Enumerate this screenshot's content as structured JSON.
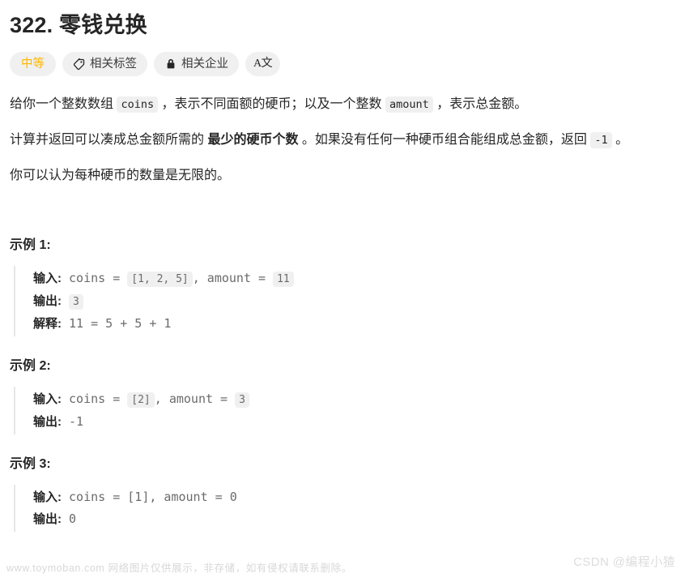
{
  "problem": {
    "title": "322. 零钱兑换",
    "number": "322.",
    "name": "零钱兑换"
  },
  "badges": {
    "difficulty": "中等",
    "tags": "相关标签",
    "companies": "相关企业",
    "translate_glyph": "A文"
  },
  "description": {
    "p1_a": "给你一个整数数组 ",
    "p1_code1": "coins",
    "p1_b": " ，表示不同面额的硬币；以及一个整数 ",
    "p1_code2": "amount",
    "p1_c": " ，表示总金额。",
    "p2_a": "计算并返回可以凑成总金额所需的 ",
    "p2_bold": "最少的硬币个数",
    "p2_b": " 。如果没有任何一种硬币组合能组成总金额，返回 ",
    "p2_code": "-1",
    "p2_c": " 。",
    "p3": "你可以认为每种硬币的数量是无限的。"
  },
  "examples": [
    {
      "title": "示例 1:",
      "input_label": "输入:",
      "input_pre": " coins = ",
      "input_code1": "[1, 2, 5]",
      "input_mid": ", amount = ",
      "input_code2": "11",
      "output_label": "输出:",
      "output_code": "3",
      "explain_label": "解释:",
      "explain_text": " 11 = 5 + 5 + 1"
    },
    {
      "title": "示例 2:",
      "input_label": "输入:",
      "input_pre": " coins = ",
      "input_code1": "[2]",
      "input_mid": ", amount = ",
      "input_code2": "3",
      "output_label": "输出:",
      "output_text": " -1"
    },
    {
      "title": "示例 3:",
      "input_label": "输入:",
      "input_text": " coins = [1], amount = 0",
      "output_label": "输出:",
      "output_text": " 0"
    }
  ],
  "watermarks": {
    "left": "www.toymoban.com 网络图片仅供展示，非存储，如有侵权请联系删除。",
    "right": "CSDN @编程小猹"
  },
  "colors": {
    "difficulty_orange": "#ffb800",
    "badge_bg": "#f0f0f0",
    "text": "#262626",
    "code_text": "#6b6b6b",
    "quote_border": "#e6e6e6",
    "watermark": "#dddddd"
  }
}
